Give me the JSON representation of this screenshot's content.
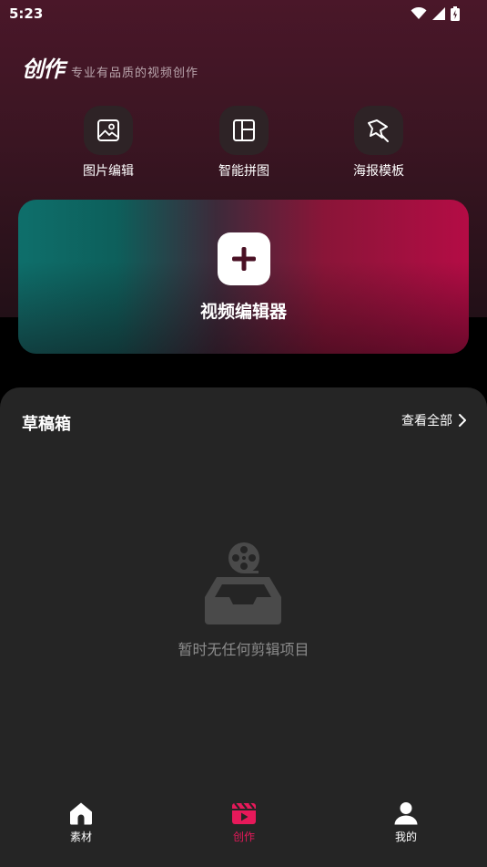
{
  "status_bar": {
    "time": "5:23"
  },
  "brand": {
    "title": "创作",
    "subtitle": "专业有品质的视频创作"
  },
  "tools": [
    {
      "label": "图片编辑",
      "icon": "image-edit-icon"
    },
    {
      "label": "智能拼图",
      "icon": "collage-layout-icon"
    },
    {
      "label": "海报模板",
      "icon": "poster-template-icon"
    }
  ],
  "editor": {
    "label": "视频编辑器",
    "icon": "plus-icon"
  },
  "drafts": {
    "title": "草稿箱",
    "view_all": "查看全部",
    "empty_text": "暂时无任何剪辑项目"
  },
  "nav": {
    "items": [
      {
        "label": "素材",
        "icon": "home-icon",
        "active": false
      },
      {
        "label": "创作",
        "icon": "film-clapper-icon",
        "active": true
      },
      {
        "label": "我的",
        "icon": "profile-icon",
        "active": false
      }
    ]
  },
  "colors": {
    "accent": "#e6195a",
    "panel": "#252525",
    "header_top": "#4a1729"
  }
}
